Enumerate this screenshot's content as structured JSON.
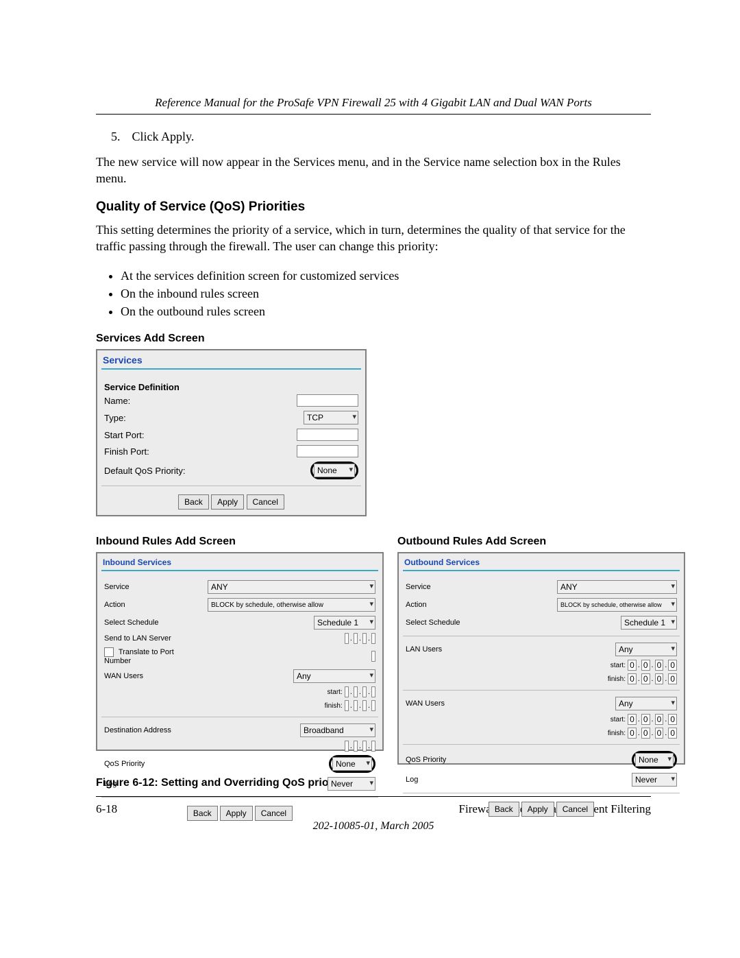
{
  "header": {
    "running_title": "Reference Manual for the ProSafe VPN Firewall 25 with 4 Gigabit LAN and Dual WAN Ports"
  },
  "step5": {
    "num": "5.",
    "text": "Click Apply."
  },
  "paragraph1": "The new service will now appear in the Services menu, and in the Service name selection box in the Rules menu.",
  "section_qos_title": "Quality of Service (QoS) Priorities",
  "paragraph2": "This setting determines the priority of a service, which in turn, determines the quality of that service for the traffic passing through the firewall. The user can change this priority:",
  "bullets": [
    "At the services definition screen for customized services",
    "On the inbound rules screen",
    "On the outbound rules screen"
  ],
  "services_heading": "Services Add Screen",
  "services": {
    "panel_title": "Services",
    "def_label": "Service Definition",
    "rows": {
      "name": "Name:",
      "type": "Type:",
      "type_value": "TCP",
      "start": "Start Port:",
      "finish": "Finish Port:",
      "qos": "Default QoS Priority:",
      "qos_value": "None"
    },
    "buttons": {
      "back": "Back",
      "apply": "Apply",
      "cancel": "Cancel"
    }
  },
  "inbound_heading": "Inbound Rules Add Screen",
  "outbound_heading": "Outbound Rules Add Screen",
  "inbound": {
    "panel_title": "Inbound Services",
    "labels": {
      "service": "Service",
      "action": "Action",
      "schedule": "Select Schedule",
      "send_lan": "Send to LAN Server",
      "translate": "Translate to Port Number",
      "wan_users": "WAN Users",
      "start": "start:",
      "finish": "finish:",
      "dest": "Destination Address",
      "qos": "QoS Priority",
      "log": "Log"
    },
    "values": {
      "service": "ANY",
      "action": "BLOCK by schedule, otherwise allow",
      "schedule": "Schedule 1",
      "wan_users": "Any",
      "dest": "Broadband",
      "qos": "None",
      "log": "Never"
    },
    "buttons": {
      "back": "Back",
      "apply": "Apply",
      "cancel": "Cancel"
    }
  },
  "outbound": {
    "panel_title": "Outbound Services",
    "labels": {
      "service": "Service",
      "action": "Action",
      "schedule": "Select Schedule",
      "lan_users": "LAN Users",
      "wan_users": "WAN Users",
      "start": "start:",
      "finish": "finish:",
      "qos": "QoS Priority",
      "log": "Log"
    },
    "values": {
      "service": "ANY",
      "action": "BLOCK by schedule, otherwise allow",
      "schedule": "Schedule 1",
      "lan_users": "Any",
      "wan_users": "Any",
      "ip_zero": "0",
      "qos": "None",
      "log": "Never"
    },
    "buttons": {
      "back": "Back",
      "apply": "Apply",
      "cancel": "Cancel"
    }
  },
  "figure_caption": "Figure 6-12:  Setting and Overriding QoS priorities",
  "footer": {
    "page_num": "6-18",
    "chapter": "Firewall Protection and Content Filtering",
    "docid": "202-10085-01, March 2005"
  }
}
